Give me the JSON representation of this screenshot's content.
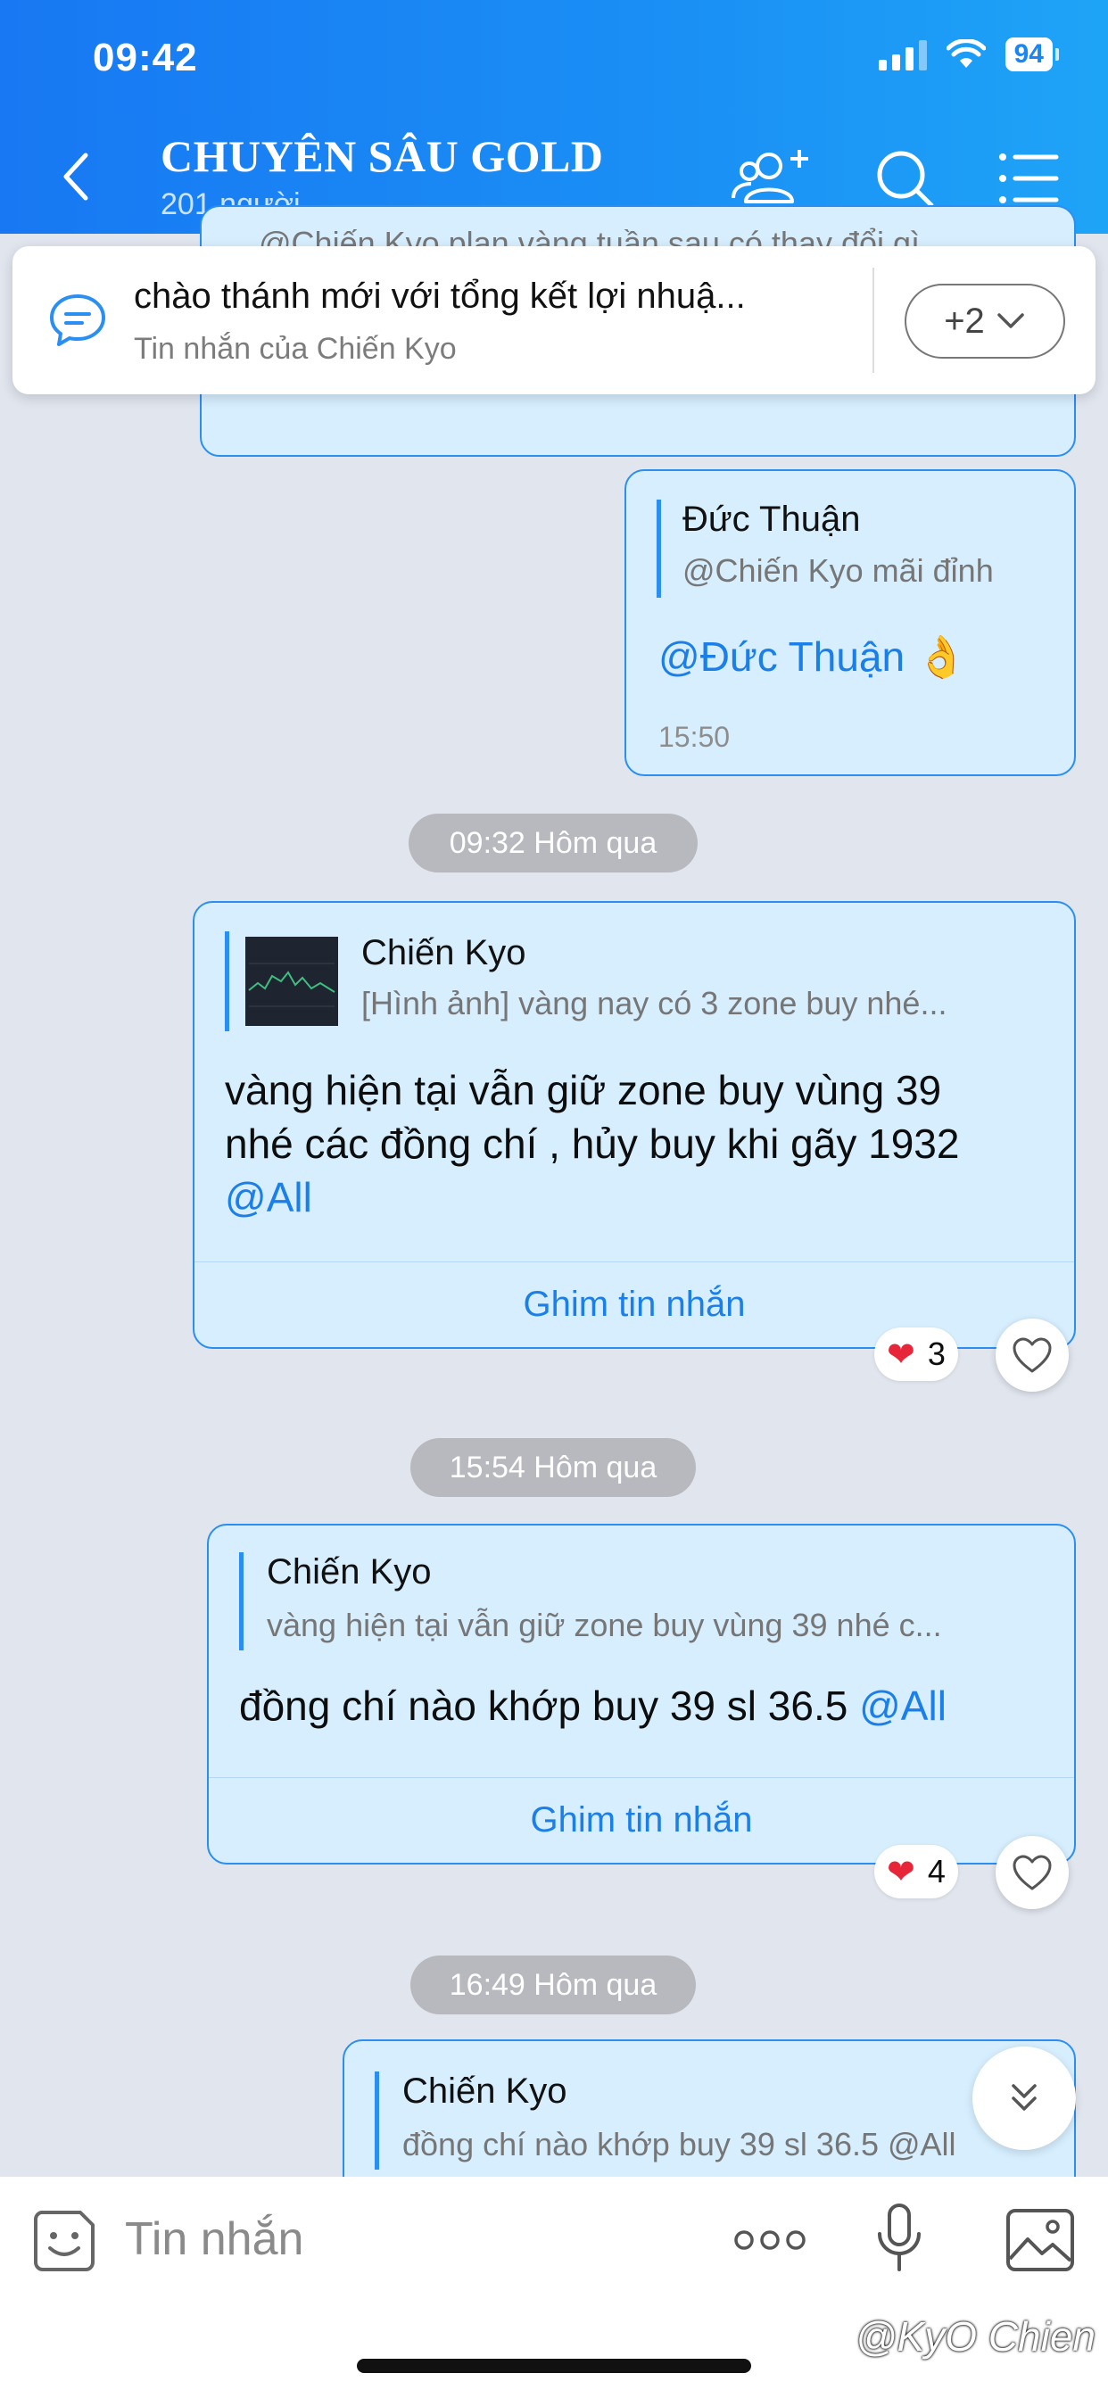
{
  "status": {
    "time": "09:42",
    "battery": "94"
  },
  "header": {
    "title": "CHUYÊN SÂU GOLD",
    "subtitle": "201 người"
  },
  "pinned": {
    "text": "chào thánh mới với tổng kết lợi nhuậ...",
    "sub": "Tin nhắn của Chiến Kyo",
    "more": "+2"
  },
  "top_partial": {
    "text": "@Chiến Kyo plan vàng tuần sau có thay đổi gì"
  },
  "messages": {
    "m1": {
      "quote_author": "Đức Thuận",
      "quote_text": "@Chiến Kyo mãi đỉnh",
      "mention": "@Đức Thuận",
      "emoji": "👌",
      "time": "15:50"
    },
    "ts1": "09:32 Hôm qua",
    "m2": {
      "quote_author": "Chiến Kyo",
      "quote_text": "[Hình ảnh] vàng nay có 3 zone buy nhé...",
      "line1": "vàng hiện tại vẫn giữ zone buy vùng 39",
      "line2": "nhé các đồng chí , hủy buy khi gãy 1932",
      "mention": "@All",
      "pin": "Ghim tin nhắn",
      "reaction_count": "3"
    },
    "ts2": "15:54 Hôm qua",
    "m3": {
      "quote_author": "Chiến Kyo",
      "quote_text": "vàng hiện tại vẫn giữ zone buy vùng 39 nhé c...",
      "text": "đồng chí nào khớp buy 39 sl 36.5",
      "mention": "@All",
      "pin": "Ghim tin nhắn",
      "reaction_count": "4"
    },
    "ts3": "16:49 Hôm qua",
    "m4": {
      "quote_author": "Chiến Kyo",
      "quote_text": "đồng chí nào khớp buy 39 sl 36.5 @All"
    }
  },
  "input": {
    "placeholder": "Tin nhắn"
  },
  "watermark": "@KyO Chien",
  "colors": {
    "header_start": "#1878f3",
    "header_end": "#1ea4f7",
    "bubble": "#d6eefe",
    "bubble_border": "#2a8ef2",
    "mention": "#1b7fea"
  }
}
